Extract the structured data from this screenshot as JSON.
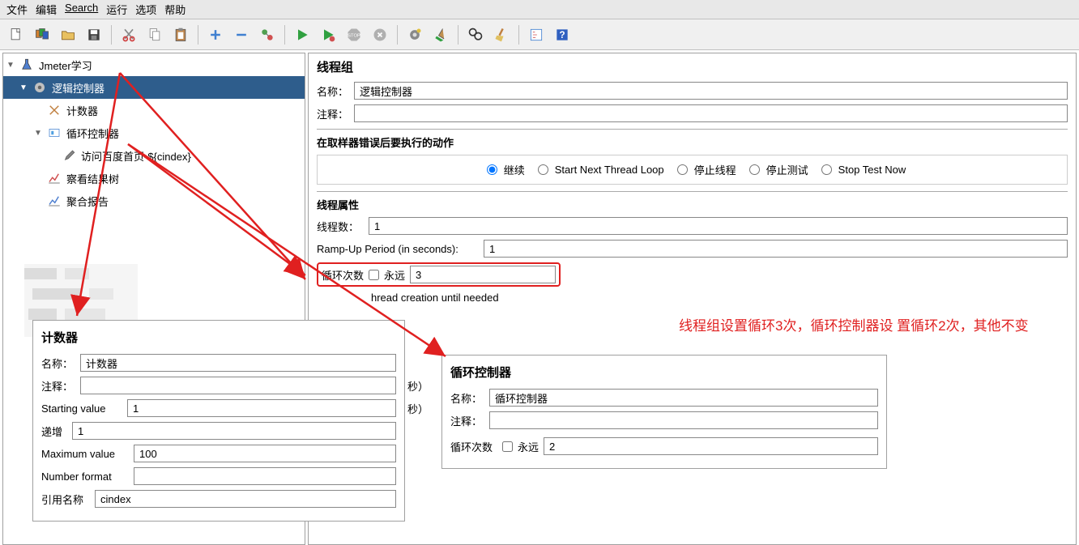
{
  "menu": {
    "items": [
      "文件",
      "编辑",
      "Search",
      "运行",
      "选项",
      "帮助"
    ]
  },
  "tree": {
    "root": "Jmeter学习",
    "selected": "逻辑控制器",
    "items": [
      "计数器",
      "循环控制器",
      "访问百度首页-${cindex}",
      "察看结果树",
      "聚合报告"
    ]
  },
  "thread_group": {
    "title": "线程组",
    "name_label": "名称：",
    "name_value": "逻辑控制器",
    "comment_label": "注释：",
    "error_header": "在取样器错误后要执行的动作",
    "radios": [
      "继续",
      "Start Next Thread Loop",
      "停止线程",
      "停止测试",
      "Stop Test Now"
    ],
    "props_header": "线程属性",
    "threads_label": "线程数：",
    "threads_value": "1",
    "rampup_label": "Ramp-Up Period (in seconds):",
    "rampup_value": "1",
    "loop_label": "循环次数",
    "forever_label": "永远",
    "loop_value": "3",
    "delay_label": "hread creation until needed"
  },
  "counter_panel": {
    "title": "计数器",
    "name_label": "名称：",
    "name_value": "计数器",
    "comment_label": "注释：",
    "seconds_suffix": "秒）",
    "starting_label": "Starting value",
    "starting_value": "1",
    "increment_label": "递增",
    "increment_value": "1",
    "max_label": "Maximum value",
    "max_value": "100",
    "format_label": "Number format",
    "ref_label": "引用名称",
    "ref_value": "cindex"
  },
  "loop_panel": {
    "title": "循环控制器",
    "name_label": "名称：",
    "name_value": "循环控制器",
    "comment_label": "注释：",
    "loop_label": "循环次数",
    "forever_label": "永远",
    "loop_value": "2"
  },
  "annotation": "线程组设置循环3次，循环控制器设\n置循环2次，其他不变"
}
